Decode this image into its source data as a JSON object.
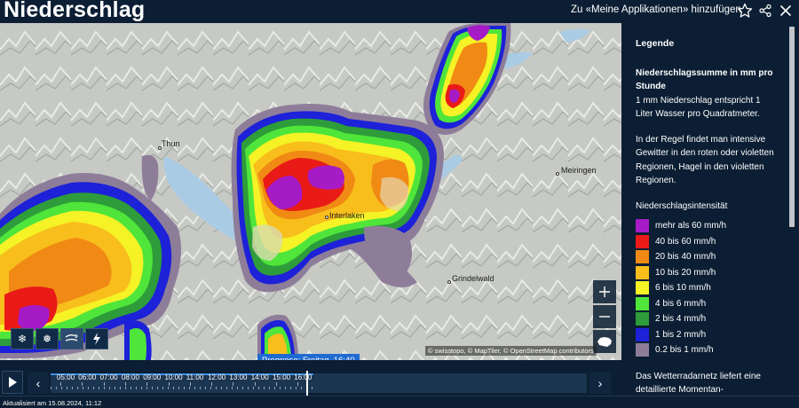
{
  "header": {
    "title": "Niederschlag",
    "add_to_apps": "Zu «Meine Applikationen» hinzufügen",
    "icons": [
      "star-icon",
      "share-icon",
      "close-icon"
    ]
  },
  "map": {
    "places": [
      "Thun",
      "Interlaken",
      "Meiringen",
      "Grindelwald"
    ],
    "attribution": "© swisstopo, © MapTiler, © OpenStreetMap contributors",
    "controls": [
      "layer-hail-icon",
      "layer-snow-icon",
      "layer-wind-icon",
      "layer-lightning-icon"
    ],
    "zoom_icons": [
      "zoom-in-icon",
      "zoom-out-icon",
      "switzerland-icon"
    ]
  },
  "legend": {
    "title": "Legende",
    "heading": "Niederschlagssumme in mm pro Stunde",
    "line1": "1 mm Niederschlag entspricht 1 Liter Wasser pro Quadratmeter.",
    "para2": "In der Regel findet man intensive Gewitter in den roten oder violetten Regionen, Hagel in den violetten Regionen.",
    "intensity_heading": "Niederschlagsintensität",
    "items": [
      {
        "label": "mehr als 60 mm/h",
        "color": "#a51cc7"
      },
      {
        "label": "40 bis 60 mm/h",
        "color": "#ea1b17"
      },
      {
        "label": "20 bis 40 mm/h",
        "color": "#f08a14"
      },
      {
        "label": "10 bis 20 mm/h",
        "color": "#f8be1c"
      },
      {
        "label": "6 bis 10 mm/h",
        "color": "#f5f226"
      },
      {
        "label": "4 bis 6 mm/h",
        "color": "#4fe53a"
      },
      {
        "label": "2 bis 4 mm/h",
        "color": "#2e9c3a"
      },
      {
        "label": "1 bis 2 mm/h",
        "color": "#1d21d8"
      },
      {
        "label": "0.2 bis 1 mm/h",
        "color": "#8e7d99"
      }
    ],
    "footer_text": "Das Wetterradarnetz liefert eine detaillierte Momentan-"
  },
  "timeline": {
    "prognose_label": "Prognose: Freitag, 16:40",
    "hours": [
      "05:00",
      "06:00",
      "07:00",
      "08:00",
      "09:00",
      "10:00",
      "11:00",
      "12:00",
      "13:00",
      "14:00",
      "15:00",
      "16:00"
    ],
    "prev_label": "‹",
    "next_label": "›",
    "progress": 0.49
  },
  "footer": {
    "updated": "Aktualisiert am 15.08.2024, 11:12"
  }
}
